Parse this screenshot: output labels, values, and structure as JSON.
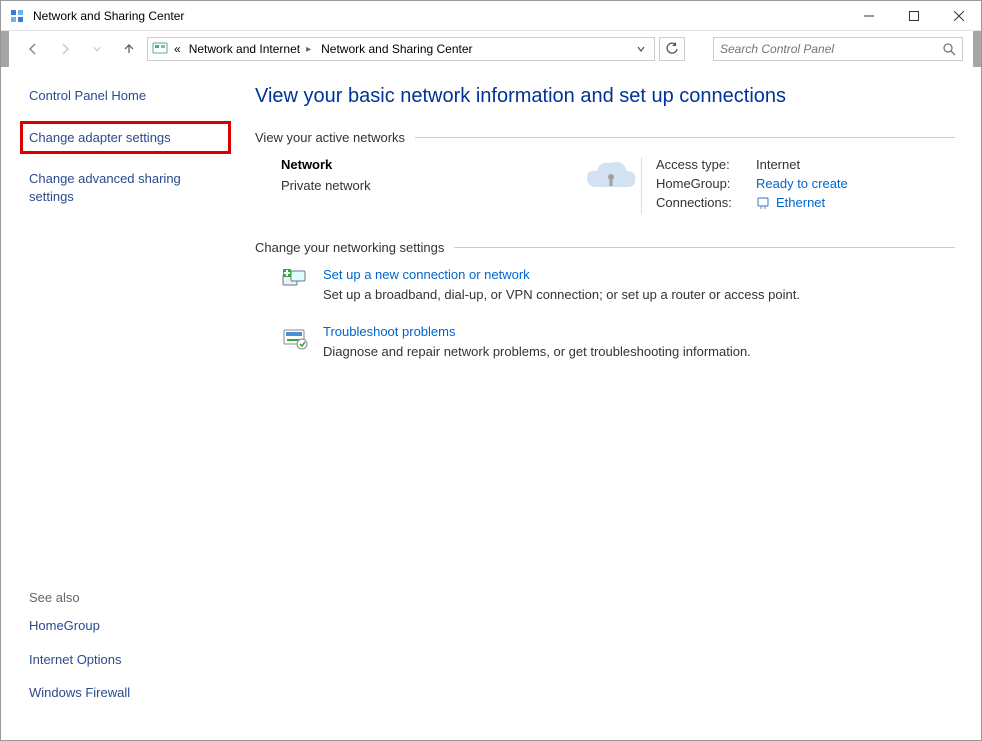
{
  "window": {
    "title": "Network and Sharing Center"
  },
  "breadcrumb": {
    "prefix": "«",
    "item1": "Network and Internet",
    "item2": "Network and Sharing Center"
  },
  "search": {
    "placeholder": "Search Control Panel"
  },
  "sidebar": {
    "home": "Control Panel Home",
    "adapter": "Change adapter settings",
    "advanced": "Change advanced sharing settings",
    "see_also_label": "See also",
    "homegroup": "HomeGroup",
    "internet_options": "Internet Options",
    "firewall": "Windows Firewall"
  },
  "main": {
    "title": "View your basic network information and set up connections",
    "active_heading": "View your active networks",
    "network": {
      "name": "Network",
      "type": "Private network",
      "access_type_label": "Access type:",
      "access_type_value": "Internet",
      "homegroup_label": "HomeGroup:",
      "homegroup_value": "Ready to create",
      "connections_label": "Connections:",
      "connections_value": "Ethernet"
    },
    "change_heading": "Change your networking settings",
    "setup": {
      "title": "Set up a new connection or network",
      "desc": "Set up a broadband, dial-up, or VPN connection; or set up a router or access point."
    },
    "troubleshoot": {
      "title": "Troubleshoot problems",
      "desc": "Diagnose and repair network problems, or get troubleshooting information."
    }
  }
}
